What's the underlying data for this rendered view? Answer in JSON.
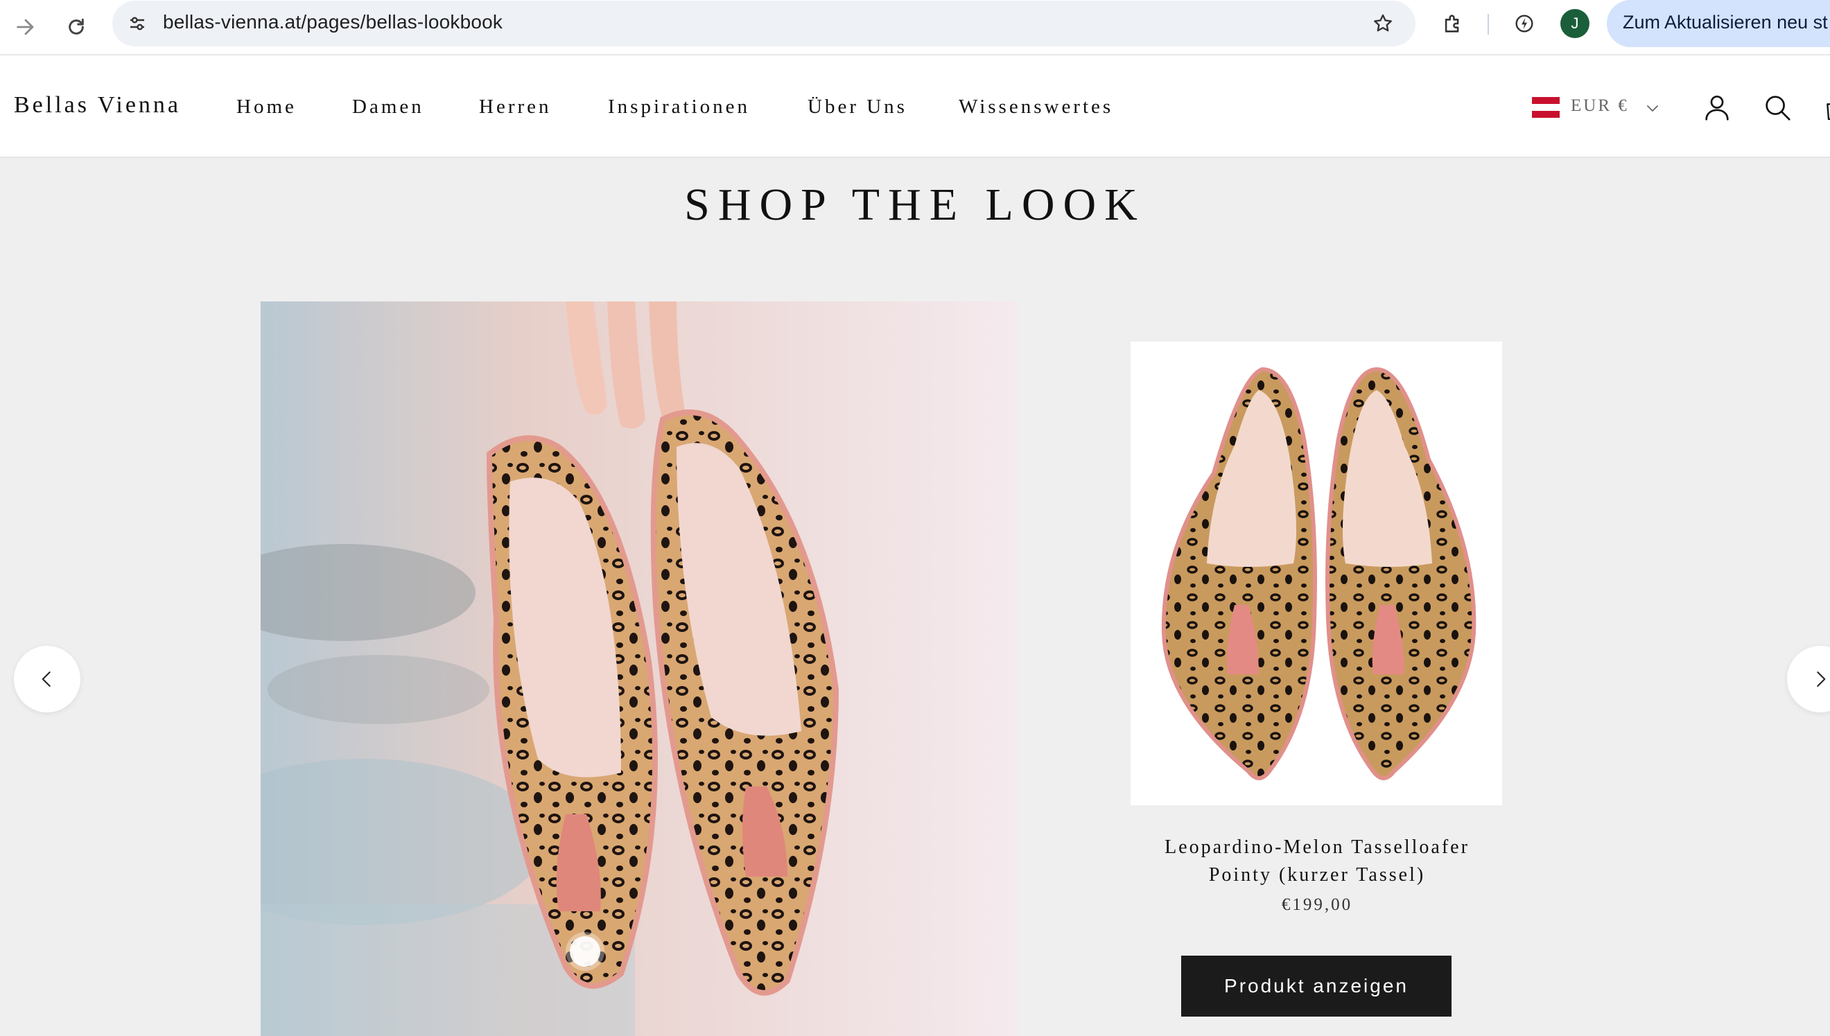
{
  "browser": {
    "url": "bellas-vienna.at/pages/bellas-lookbook",
    "avatar_initial": "J",
    "update_label": "Zum Aktualisieren neu st"
  },
  "header": {
    "brand": "Bellas Vienna",
    "nav": [
      "Home",
      "Damen",
      "Herren",
      "Inspirationen",
      "Über Uns",
      "Wissenswertes"
    ],
    "currency": "EUR €"
  },
  "main": {
    "title": "SHOP THE LOOK",
    "product": {
      "name_line1": "Leopardino-Melon Tasselloafer",
      "name_line2": "Pointy (kurzer Tassel)",
      "price": "€199,00",
      "cta_label": "Produkt anzeigen"
    }
  },
  "colors": {
    "cta_bg": "#1b1b1b",
    "page_bg": "#efefef",
    "flag_red": "#c8102e"
  },
  "icons": [
    "arrow-forward-icon",
    "reload-icon",
    "site-settings-icon",
    "star-icon",
    "extensions-icon",
    "performance-icon",
    "austria-flag-icon",
    "chevron-down-icon",
    "account-icon",
    "search-icon",
    "cart-icon",
    "chevron-left-icon",
    "chevron-right-icon"
  ]
}
